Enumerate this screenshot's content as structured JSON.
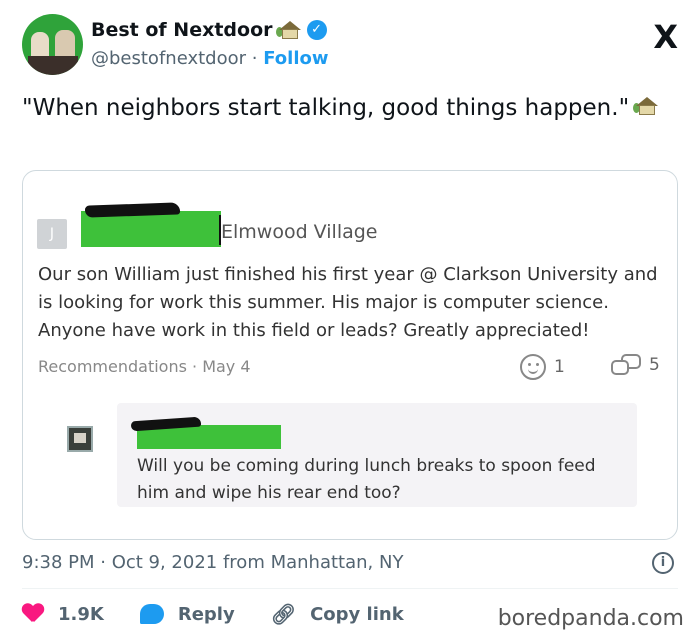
{
  "header": {
    "name": "Best of Nextdoor",
    "handle": "@bestofnextdoor",
    "separator": "·",
    "follow_label": "Follow",
    "x_logo": "X"
  },
  "tweet": {
    "text": "\"When neighbors start talking, good things happen.\""
  },
  "post": {
    "avatar_letter": "J",
    "location": "Elmwood Village",
    "body": "Our son William just finished his first year @ Clarkson University and is looking for work this summer. His major is computer science. Anyone have work in this field or leads? Greatly appreciated!",
    "meta": "Recommendations · May 4",
    "reactions_count": "1",
    "comments_count": "5"
  },
  "comment": {
    "text": "Will you be coming during lunch breaks to spoon feed him and wipe his rear end too?"
  },
  "footer": {
    "timestamp": "9:38 PM · Oct 9, 2021 from Manhattan, NY",
    "info_icon": "i",
    "likes": "1.9K",
    "reply_label": "Reply",
    "copy_link_label": "Copy link",
    "watermark": "boredpanda.com"
  },
  "colors": {
    "accent": "#1d9bf0",
    "like": "#f91880",
    "redaction": "#3ec13a"
  }
}
